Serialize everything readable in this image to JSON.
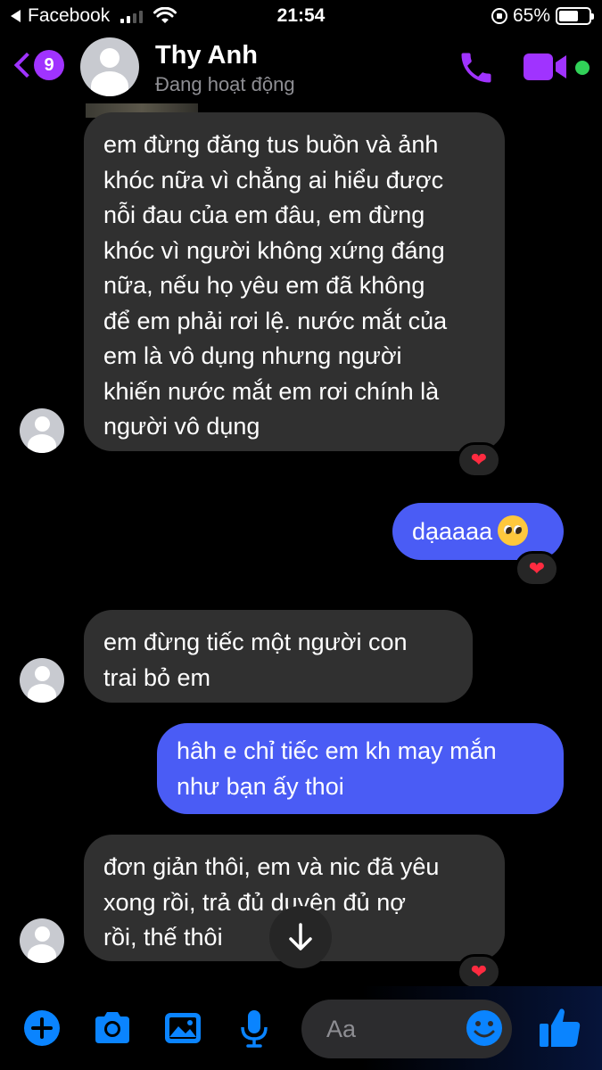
{
  "status_bar": {
    "back_app": "Facebook",
    "time": "21:54",
    "battery": "65%",
    "battery_level": 0.65
  },
  "header": {
    "unread_count": "9",
    "contact_name": "Thy Anh",
    "contact_status": "Đang hoạt động",
    "accent_color": "#a033ff",
    "online_color": "#31d158",
    "icons": [
      "back-chevron-icon",
      "phone-icon",
      "video-camera-icon"
    ]
  },
  "messages": [
    {
      "direction": "incoming",
      "lines": [
        "em đừng đăng tus buồn và ảnh",
        "khóc nữa vì chẳng ai hiểu được",
        "nỗi đau của em đâu, em đừng",
        "khóc vì người không xứng đáng",
        "nữa, nếu họ yêu em đã không",
        "để em phải rơi lệ. nước mắt của",
        "em là vô dụng nhưng người",
        "khiến nước mắt em rơi chính là",
        "người vô dụng"
      ],
      "reaction": "❤"
    },
    {
      "direction": "outgoing",
      "lines": [
        "dạaaaa"
      ],
      "emoji": "pleading-face-emoji",
      "reaction": "❤"
    },
    {
      "direction": "incoming",
      "lines": [
        "em đừng tiếc một người con",
        "trai bỏ em"
      ]
    },
    {
      "direction": "outgoing",
      "lines": [
        "hâh e chỉ tiếc em kh may mắn",
        "như bạn ấy thoi"
      ]
    },
    {
      "direction": "incoming",
      "lines": [
        "đơn giản thôi, em và nic đã yêu",
        "xong rồi, trả đủ duyên đủ nợ",
        "rồi, thế thôi"
      ],
      "reaction": "❤"
    }
  ],
  "composer": {
    "placeholder": "Aa",
    "icons": [
      "plus-icon",
      "camera-icon",
      "photo-icon",
      "microphone-icon",
      "emoji-icon",
      "thumbs-up-icon"
    ]
  },
  "colors": {
    "incoming_bubble": "#303030",
    "outgoing_bubble": "#4a5cf5",
    "bottom_icons": "#0a84ff",
    "reaction_heart": "#ff2b40"
  }
}
